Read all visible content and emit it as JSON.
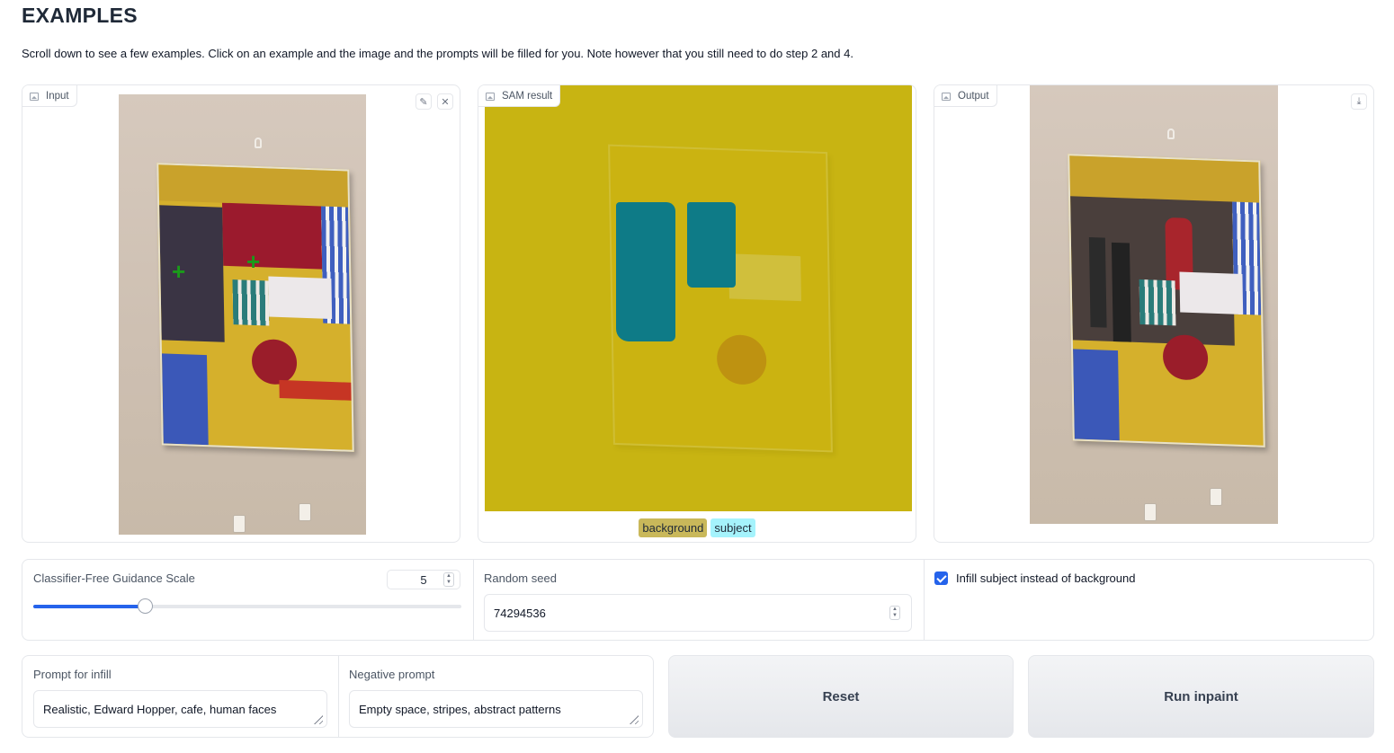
{
  "page": {
    "title": "EXAMPLES",
    "description": "Scroll down to see a few examples. Click on an example and the image and the prompts will be filled for you. Note however that you still need to do step 2 and 4."
  },
  "panels": {
    "input": {
      "label": "Input",
      "edit_icon": "pencil-icon",
      "clear_icon": "close-icon"
    },
    "sam": {
      "label": "SAM result",
      "legend": [
        "background",
        "subject"
      ],
      "legend_colors": {
        "background": "#c9b85a",
        "subject": "#a5f3fc"
      }
    },
    "output": {
      "label": "Output",
      "download_icon": "download-icon"
    }
  },
  "controls": {
    "guidance": {
      "label": "Classifier-Free Guidance Scale",
      "value": "5",
      "slider_fraction": 0.26
    },
    "seed": {
      "label": "Random seed",
      "value": "74294536"
    },
    "infill": {
      "label": "Infill subject instead of background",
      "checked": true
    }
  },
  "prompts": {
    "infill": {
      "label": "Prompt for infill",
      "value": "Realistic, Edward Hopper, cafe, human faces"
    },
    "negative": {
      "label": "Negative prompt",
      "value": "Empty space, stripes, abstract patterns"
    }
  },
  "buttons": {
    "reset": "Reset",
    "run": "Run inpaint"
  },
  "colors": {
    "accent": "#2563eb",
    "mask_subject": "#0e7b87",
    "mask_background": "#c8b40a"
  }
}
